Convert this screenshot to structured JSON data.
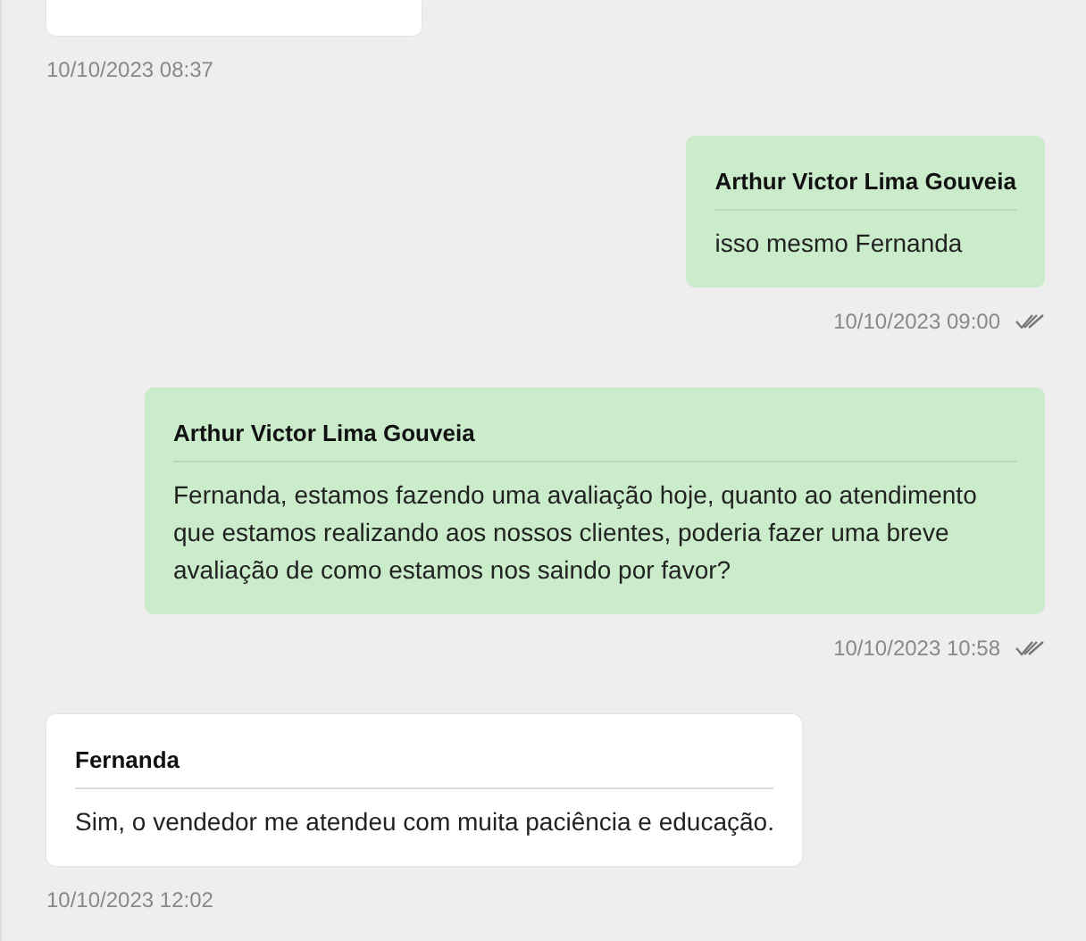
{
  "messages": [
    {
      "kind": "incoming",
      "time": "10/10/2023 08:37"
    },
    {
      "kind": "outgoing",
      "sender": "Arthur Victor Lima Gouveia",
      "text": "isso mesmo Fernanda",
      "time": "10/10/2023 09:00",
      "read": true
    },
    {
      "kind": "outgoing",
      "sender": "Arthur Victor Lima Gouveia",
      "text": "Fernanda, estamos fazendo uma avaliação hoje, quanto ao atendimento que estamos realizando aos nossos clientes, poderia fazer uma breve avaliação de como estamos nos saindo por favor?",
      "time": "10/10/2023 10:58",
      "read": true
    },
    {
      "kind": "incoming",
      "sender": "Fernanda",
      "text": "Sim, o vendedor me atendeu com muita paciência e educação.",
      "time": "10/10/2023 12:02"
    }
  ]
}
